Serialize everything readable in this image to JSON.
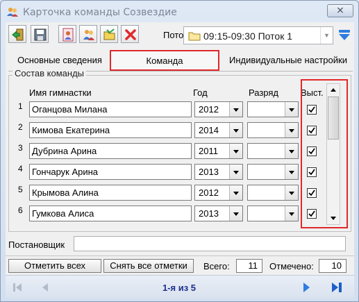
{
  "window": {
    "title": "Карточка команды Созвездие",
    "close_glyph": "⨯"
  },
  "toolbar": {
    "icons": [
      "exit-door-icon",
      "save-icon",
      "card-person-icon",
      "people-icon",
      "folder-open-icon",
      "delete-icon"
    ],
    "stream_label": "Поток:",
    "stream_value": "09:15-09:30 Поток 1",
    "filter_icon": "filter-icon"
  },
  "tabs": {
    "main": "Основные сведения",
    "team": "Команда",
    "individual": "Индивидуальные настройки"
  },
  "team_group": {
    "title": "Состав команды",
    "col_name": "Имя гимнастки",
    "col_year": "Год",
    "col_rank": "Разряд",
    "col_perform": "Выст.",
    "rows": [
      {
        "num": "1",
        "name": "Оганцова Милана",
        "year": "2012",
        "rank": "",
        "performs": true
      },
      {
        "num": "2",
        "name": "Кимова Екатерина",
        "year": "2014",
        "rank": "",
        "performs": true
      },
      {
        "num": "3",
        "name": "Дубрина Арина",
        "year": "2011",
        "rank": "",
        "performs": true
      },
      {
        "num": "4",
        "name": "Гончарук Арина",
        "year": "2013",
        "rank": "",
        "performs": true
      },
      {
        "num": "5",
        "name": "Крымова Алина",
        "year": "2012",
        "rank": "",
        "performs": true
      },
      {
        "num": "6",
        "name": "Гумкова Алиса",
        "year": "2013",
        "rank": "",
        "performs": true
      }
    ]
  },
  "director": {
    "label": "Постановщик",
    "value": ""
  },
  "actions": {
    "mark_all": "Отметить всех",
    "unmark_all": "Снять все отметки",
    "total_label": "Всего:",
    "total_value": "11",
    "marked_label": "Отмечено:",
    "marked_value": "10"
  },
  "navigator": {
    "text": "1-я из 5"
  },
  "colors": {
    "highlight": "#e0282a",
    "nav_text": "#1e2f8c",
    "nav_arrow": "#2f7be0"
  }
}
